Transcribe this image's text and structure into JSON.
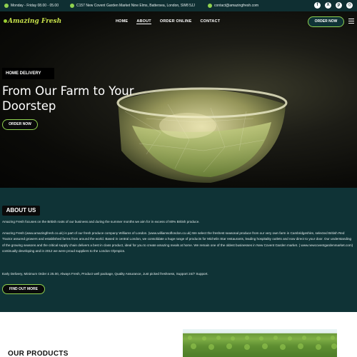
{
  "topbar": {
    "hours": "Monday - Friday 08.00 - 05.00",
    "address": "C157 New Covent Garden Market Nine Elms, Battersea, London, SW8 5JJ",
    "email": "contact@amazingfresh.com",
    "socials": [
      {
        "icon": "facebook-icon",
        "glyph": "f"
      },
      {
        "icon": "x-icon",
        "glyph": "X"
      },
      {
        "icon": "pinterest-icon",
        "glyph": "p"
      },
      {
        "icon": "instagram-icon",
        "glyph": "◎"
      }
    ]
  },
  "nav": {
    "logo": "Amazing Fresh",
    "items": [
      "HOME",
      "ABOUT",
      "ORDER ONLINE",
      "CONTACT"
    ],
    "active_index": 1,
    "order_button": "ORDER NOW"
  },
  "hero": {
    "badge": "HOME DELIVERY",
    "title": "From Our Farm to Your Doorstep",
    "button": "ORDER NOW"
  },
  "about": {
    "heading": "ABOUT US",
    "p1": "Amazing Fresh focuses on the British roots of our business and during the summer months we aim for in excess of 80% British produce.",
    "p2": "Amazing Fresh (www.amazingfresh.co.uk) is part of our fresh produce company Williams of London. (www.williamsoflondon.co.uk) We select the freshest seasonal produce from our very own farm in Cambridgeshire, selected British Red Tractor assured growers and established farms from around the world. Based in central London, we consolidate a huge range of products for Michelin Star restaurants, leading hospitality outlets and now direct to your door. Our understanding of the growing seasons and the critical supply chain delivers a best in class product, ideal for you to create amazing meals at home. We remain one of the oldest businesses in New Covent Garden market. ( www.newcoventgardenmarket.com) continually developing and in 2012 we were proud suppliers to the London Olympics.",
    "p3": "Early Delivery, Minimum Order £ 25.00, Always Fresh, Product well package, Quality Assurance, Just picked freshness, Support 24/7 Support.",
    "button": "FIND OUT MORE"
  },
  "products": {
    "heading": "OUR PRODUCTS"
  },
  "colors": {
    "accent": "#8fd14f",
    "dark_teal": "#0f3336",
    "topbar": "#0f2f32"
  }
}
